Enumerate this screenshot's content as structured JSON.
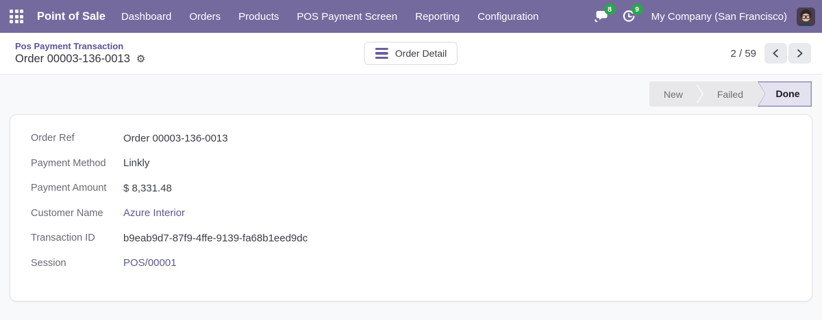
{
  "navbar": {
    "app_name": "Point of Sale",
    "menu_items": [
      "Dashboard",
      "Orders",
      "Products",
      "POS Payment Screen",
      "Reporting",
      "Configuration"
    ],
    "messages_badge": "8",
    "activities_badge": "9",
    "company": "My Company (San Francisco)"
  },
  "control_panel": {
    "breadcrumb": "Pos Payment Transaction",
    "title": "Order 00003-136-0013",
    "order_detail_button": "Order Detail",
    "pager_value": "2 / 59"
  },
  "statusbar": {
    "stages": [
      "New",
      "Failed",
      "Done"
    ],
    "active_stage": "Done"
  },
  "sheet": {
    "fields": [
      {
        "label": "Order Ref",
        "value": "Order 00003-136-0013"
      },
      {
        "label": "Payment Method",
        "value": "Linkly"
      },
      {
        "label": "Payment Amount",
        "value": "$ 8,331.48"
      },
      {
        "label": "Customer Name",
        "value": "Azure Interior",
        "link": true
      },
      {
        "label": "Transaction ID",
        "value": "b9eab9d7-87f9-4ffe-9139-fa68b1eed9dc"
      },
      {
        "label": "Session",
        "value": "POS/00001",
        "link": true
      }
    ]
  },
  "icons": {
    "apps": "apps-grid-icon",
    "messages": "chat-bubbles-icon",
    "activities": "activity-clock-icon",
    "settings": "gear-icon",
    "order_detail": "hamburger-icon",
    "pager_prev": "chevron-left-icon",
    "pager_next": "chevron-right-icon"
  },
  "colors": {
    "navbar_bg": "#746A9E",
    "badge_green": "#2DA44E",
    "accent_purple": "#5E5399",
    "link_purple": "#5D5A8C",
    "done_border": "#8E87B8",
    "done_bg": "#E5E2EF",
    "page_bg": "#F8F9FB"
  }
}
